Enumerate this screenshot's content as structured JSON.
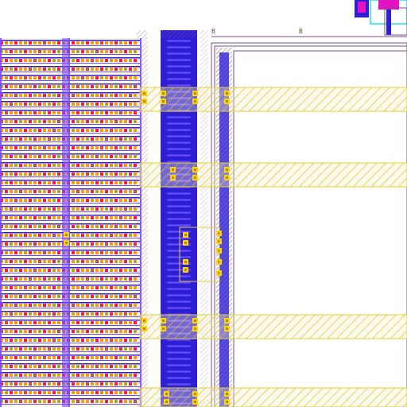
{
  "view": {
    "background": "#ffffff",
    "labels": {
      "left": "B",
      "right": "B"
    }
  },
  "palette": {
    "metal1": "#2d1fd6",
    "metal2_line": "#7a49ff",
    "poly": "#ff1a3a",
    "diffusion": "#ff9900",
    "implant": "#22cc33",
    "nwell_outline": "#7a4b8c",
    "contact": "#ffd400",
    "highlight_band": "#e6cf2e",
    "boundary": "#8b5cf6",
    "corner_cyan": "#17e3f2",
    "corner_magenta": "#e312c4"
  },
  "layers": [
    "metal1",
    "poly",
    "diffusion",
    "implant",
    "nwell",
    "contact",
    "boundary"
  ]
}
